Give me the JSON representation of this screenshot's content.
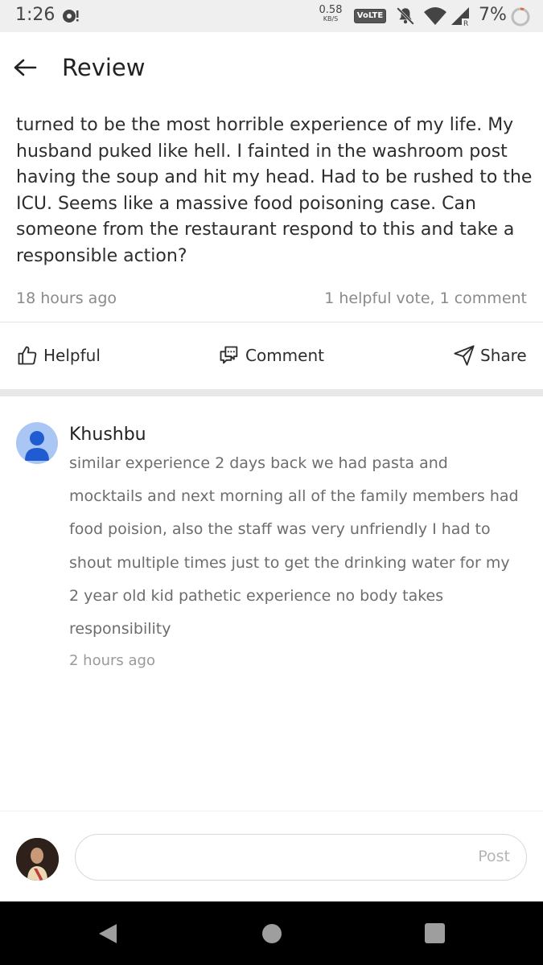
{
  "status_bar": {
    "time": "1:26",
    "speed_value": "0.58",
    "speed_unit": "KB/S",
    "network_badge": "VoLTE",
    "battery": "7%",
    "icons": [
      "notification-icon",
      "mute-icon",
      "wifi-icon",
      "signal-icon",
      "battery-icon"
    ]
  },
  "app_bar": {
    "title": "Review",
    "back_icon": "arrow-left-icon"
  },
  "review": {
    "text": "turned to be the most horrible experience of my life. My husband puked like hell. I fainted in the washroom post having the soup and hit my head. Had to be rushed to the ICU. Seems like a massive food poisoning case. Can someone from the restaurant respond to this and take a responsible action?",
    "time": "18 hours ago",
    "stats": "1 helpful vote, 1 comment"
  },
  "actions": {
    "helpful": "Helpful",
    "comment": "Comment",
    "share": "Share"
  },
  "comment": {
    "author": "Khushbu",
    "text": "similar experience 2 days back we had pasta and mocktails and next morning all of the family members had food poision, also the staff was very unfriendly I had to shout multiple times just to get the drinking water for my 2 year old kid pathetic experience no body takes responsibility",
    "time": "2 hours ago"
  },
  "composer": {
    "placeholder": "",
    "post_label": "Post"
  },
  "colors": {
    "accent": "#2d2d2d",
    "muted": "#8a8a8a",
    "avatar_blue": "#a9c6f4"
  }
}
